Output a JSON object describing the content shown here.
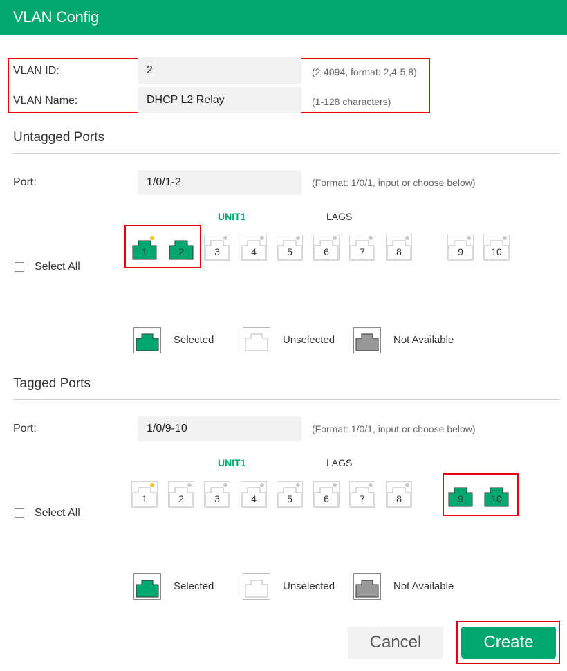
{
  "header": {
    "title": "VLAN Config"
  },
  "vlan": {
    "id_label": "VLAN ID:",
    "id_value": "2",
    "id_hint": "(2-4094, format: 2,4-5,8)",
    "name_label": "VLAN Name:",
    "name_value": "DHCP L2 Relay",
    "name_hint": "(1-128 characters)"
  },
  "untagged": {
    "title": "Untagged Ports",
    "port_label": "Port:",
    "port_value": "1/0/1-2",
    "port_hint": "(Format: 1/0/1, input or choose below)",
    "unit_label": "UNIT1",
    "lags_label": "LAGS",
    "select_all": "Select All",
    "ports": [
      {
        "num": "1",
        "state": "selected",
        "dot": "yellow"
      },
      {
        "num": "2",
        "state": "selected",
        "dot": "none"
      },
      {
        "num": "3",
        "state": "unselected",
        "dot": "gray"
      },
      {
        "num": "4",
        "state": "unselected",
        "dot": "gray"
      },
      {
        "num": "5",
        "state": "unselected",
        "dot": "gray"
      },
      {
        "num": "6",
        "state": "unselected",
        "dot": "gray"
      },
      {
        "num": "7",
        "state": "unselected",
        "dot": "gray"
      },
      {
        "num": "8",
        "state": "unselected",
        "dot": "gray"
      }
    ],
    "sfp_ports": [
      {
        "num": "9",
        "state": "unselected",
        "dot": "gray"
      },
      {
        "num": "10",
        "state": "unselected",
        "dot": "gray"
      }
    ]
  },
  "tagged": {
    "title": "Tagged Ports",
    "port_label": "Port:",
    "port_value": "1/0/9-10",
    "port_hint": "(Format: 1/0/1, input or choose below)",
    "unit_label": "UNIT1",
    "lags_label": "LAGS",
    "select_all": "Select All",
    "ports": [
      {
        "num": "1",
        "state": "unselected",
        "dot": "yellow"
      },
      {
        "num": "2",
        "state": "unselected",
        "dot": "gray"
      },
      {
        "num": "3",
        "state": "unselected",
        "dot": "gray"
      },
      {
        "num": "4",
        "state": "unselected",
        "dot": "gray"
      },
      {
        "num": "5",
        "state": "unselected",
        "dot": "gray"
      },
      {
        "num": "6",
        "state": "unselected",
        "dot": "gray"
      },
      {
        "num": "7",
        "state": "unselected",
        "dot": "gray"
      },
      {
        "num": "8",
        "state": "unselected",
        "dot": "gray"
      }
    ],
    "sfp_ports": [
      {
        "num": "9",
        "state": "selected",
        "dot": "none"
      },
      {
        "num": "10",
        "state": "selected",
        "dot": "none"
      }
    ]
  },
  "legend": {
    "selected": "Selected",
    "unselected": "Unselected",
    "not_available": "Not Available"
  },
  "buttons": {
    "cancel": "Cancel",
    "create": "Create"
  },
  "colors": {
    "brand": "#00a870",
    "highlight": "#e60012",
    "selected_fill": "#00a870",
    "unavailable_fill": "#999999",
    "link_dot": "#f5c400",
    "idle_dot": "#c8c8c8"
  }
}
